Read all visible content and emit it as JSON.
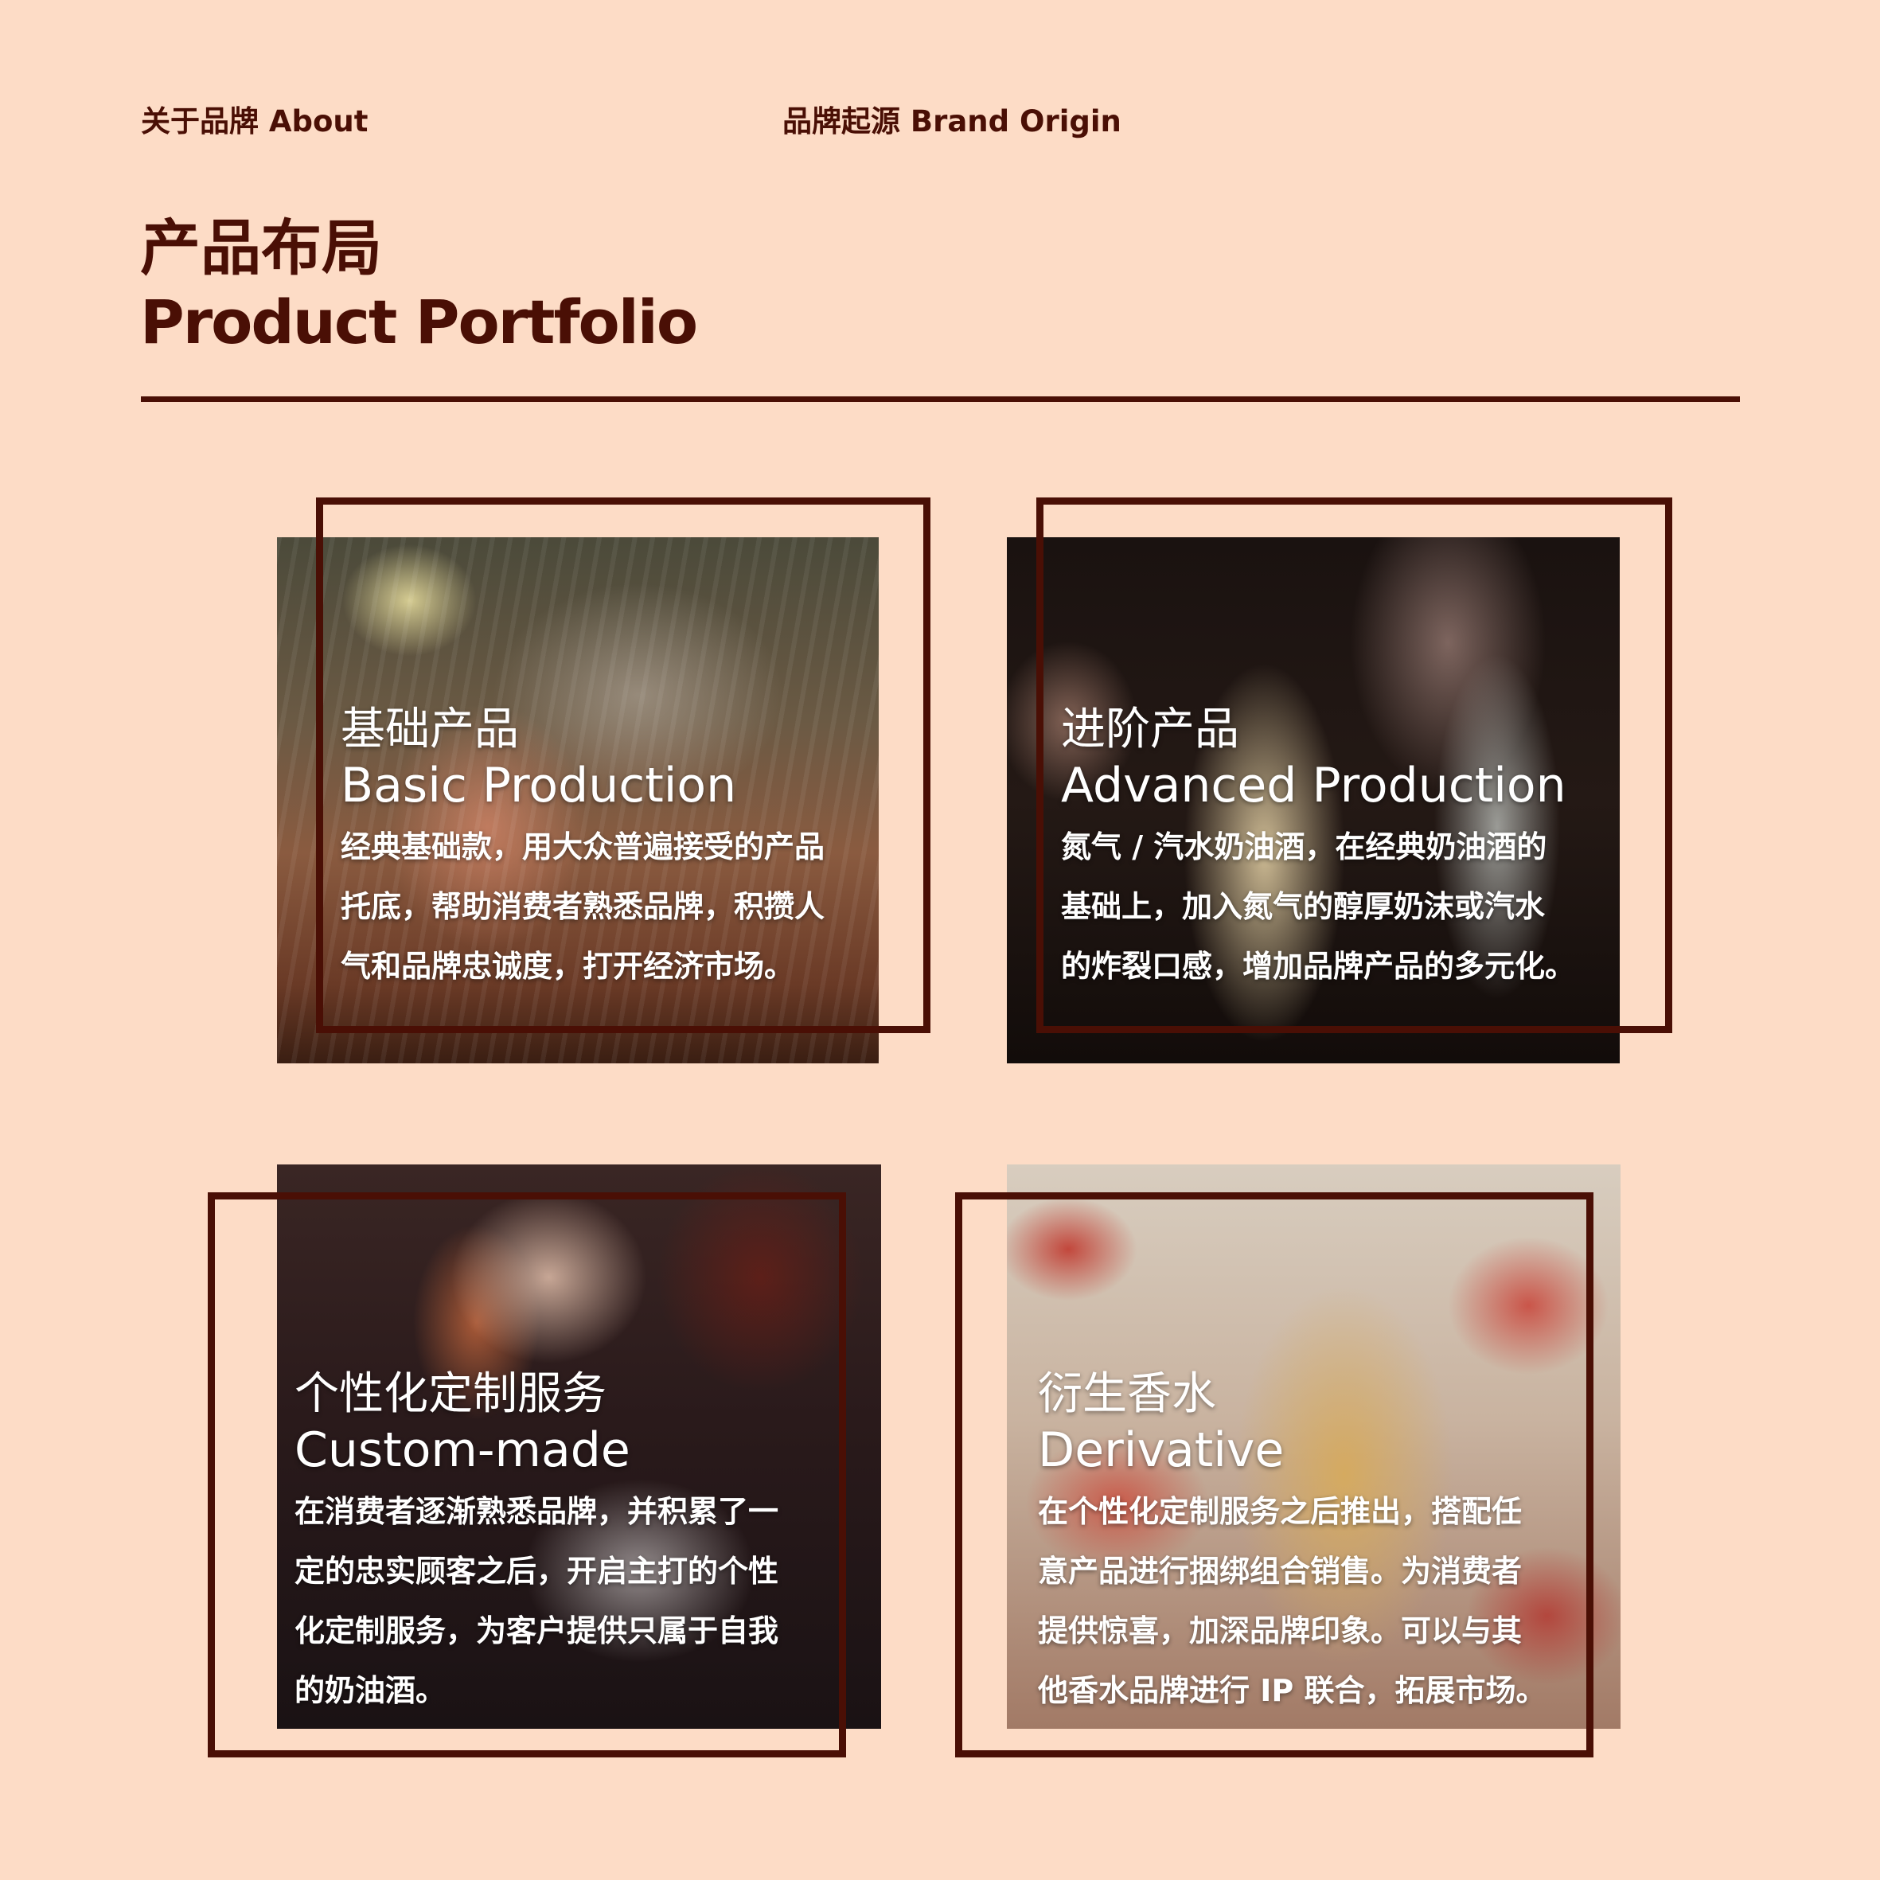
{
  "nav": {
    "about": "关于品牌 About",
    "origin": "品牌起源 Brand Origin"
  },
  "heading": {
    "cn": "产品布局",
    "en": "Product Portfolio"
  },
  "cards": [
    {
      "cn": "基础产品",
      "en": "Basic Production",
      "lines": [
        "经典基础款，用大众普遍接受的产品",
        "托底，帮助消费者熟悉品牌，积攒人",
        "气和品牌忠诚度，打开经济市场。"
      ]
    },
    {
      "cn": "进阶产品",
      "en": "Advanced Production",
      "lines": [
        "氮气 / 汽水奶油酒，在经典奶油酒的",
        "基础上，加入氮气的醇厚奶沫或汽水",
        "的炸裂口感，增加品牌产品的多元化。"
      ]
    },
    {
      "cn": "个性化定制服务",
      "en": "Custom-made",
      "lines": [
        "在消费者逐渐熟悉品牌，并积累了一",
        "定的忠实顾客之后，开启主打的个性",
        "化定制服务，为客户提供只属于自我",
        "的奶油酒。"
      ]
    },
    {
      "cn": "衍生香水",
      "en": "Derivative",
      "lines": [
        "在个性化定制服务之后推出，搭配任",
        "意产品进行捆绑组合销售。为消费者",
        "提供惊喜，加深品牌印象。可以与其",
        "他香水品牌进行 IP 联合，拓展市场。"
      ]
    }
  ],
  "colors": {
    "background": "#FDDCC6",
    "accent": "#4A0F05",
    "text_on_photo": "#FFFFFF"
  }
}
